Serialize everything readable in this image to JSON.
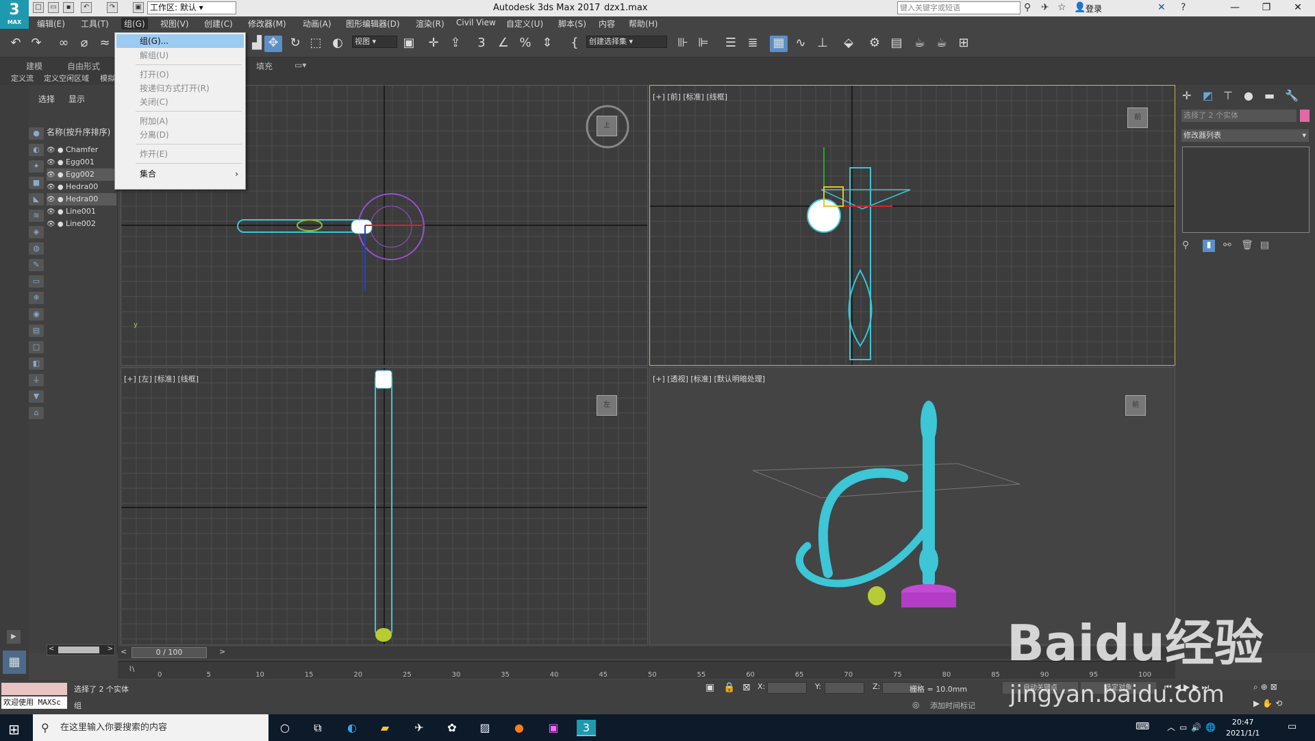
{
  "titlebar": {
    "logo": "3",
    "logo_sub": "MAX",
    "workspace": "工作区: 默认",
    "app_title": "Autodesk 3ds Max 2017",
    "file_name": "dzx1.max",
    "search_placeholder": "键入关键字或短语",
    "login": "登录"
  },
  "menubar": {
    "items": [
      "编辑(E)",
      "工具(T)",
      "组(G)",
      "视图(V)",
      "创建(C)",
      "修改器(M)",
      "动画(A)",
      "图形编辑器(D)",
      "渲染(R)",
      "Civil View",
      "自定义(U)",
      "脚本(S)",
      "内容",
      "帮助(H)"
    ]
  },
  "toolbar": {
    "view_combo": "视图",
    "selection_set": "创建选择集"
  },
  "ribbon": {
    "tabs": [
      "建模",
      "自由形式"
    ],
    "fill_tab": "填充",
    "subtabs": [
      "定义流",
      "定义空闲区域",
      "模拟"
    ]
  },
  "group_menu": {
    "items": [
      {
        "label": "组(G)...",
        "enabled": true
      },
      {
        "label": "解组(U)",
        "enabled": false
      },
      {
        "label": "打开(O)",
        "enabled": false
      },
      {
        "label": "按递归方式打开(R)",
        "enabled": false
      },
      {
        "label": "关闭(C)",
        "enabled": false
      },
      {
        "label": "附加(A)",
        "enabled": false
      },
      {
        "label": "分离(D)",
        "enabled": false
      },
      {
        "label": "炸开(E)",
        "enabled": false
      },
      {
        "label": "集合",
        "enabled": true,
        "submenu": true
      }
    ]
  },
  "scene_explorer": {
    "tabs": [
      "选择",
      "显示"
    ],
    "column_header": "名称(按升序排序)",
    "objects": [
      {
        "name": "Chamfer",
        "selected": false
      },
      {
        "name": "Egg001",
        "selected": false
      },
      {
        "name": "Egg002",
        "selected": true
      },
      {
        "name": "Hedra00",
        "selected": false
      },
      {
        "name": "Hedra00",
        "selected": true
      },
      {
        "name": "Line001",
        "selected": false
      },
      {
        "name": "Line002",
        "selected": false
      }
    ]
  },
  "viewports": {
    "top": {
      "label": "",
      "cube": "上"
    },
    "front": {
      "label": "[+] [前] [标准] [线框]",
      "cube": "前"
    },
    "left": {
      "label": "[+] [左] [标准] [线框]",
      "cube": "左"
    },
    "perspective": {
      "label": "[+] [透视] [标准] [默认明暗处理]",
      "cube": "前"
    }
  },
  "command_panel": {
    "selection_info": "选择了 2 个实体",
    "modifier_list": "修改器列表",
    "swatch_color": "#e06aa6"
  },
  "timeline": {
    "frame": "0 / 100",
    "ticks": [
      "0",
      "5",
      "10",
      "15",
      "20",
      "25",
      "30",
      "35",
      "40",
      "45",
      "50",
      "55",
      "60",
      "65",
      "70",
      "75",
      "80",
      "85",
      "90",
      "95",
      "100"
    ]
  },
  "status": {
    "welcome": "欢迎使用 MAXSc",
    "prompt1": "选择了 2 个实体",
    "prompt2": "组",
    "x_label": "X:",
    "y_label": "Y:",
    "z_label": "Z:",
    "grid": "栅格 = 10.0mm",
    "add_time_tag": "添加时间标记",
    "autokey": "自动关键点",
    "set_key": "选定对象"
  },
  "taskbar": {
    "search_placeholder": "在这里输入你要搜索的内容",
    "time": "20:47",
    "date": "2021/1/1"
  },
  "watermark": {
    "text": "Baidu经验",
    "url": "jingyan.baidu.com"
  },
  "colors": {
    "wire": "#3cc6d6",
    "selected_wire": "#ffffff",
    "accent": "#5b8fc7",
    "active_viewport": "#c8b34a"
  }
}
